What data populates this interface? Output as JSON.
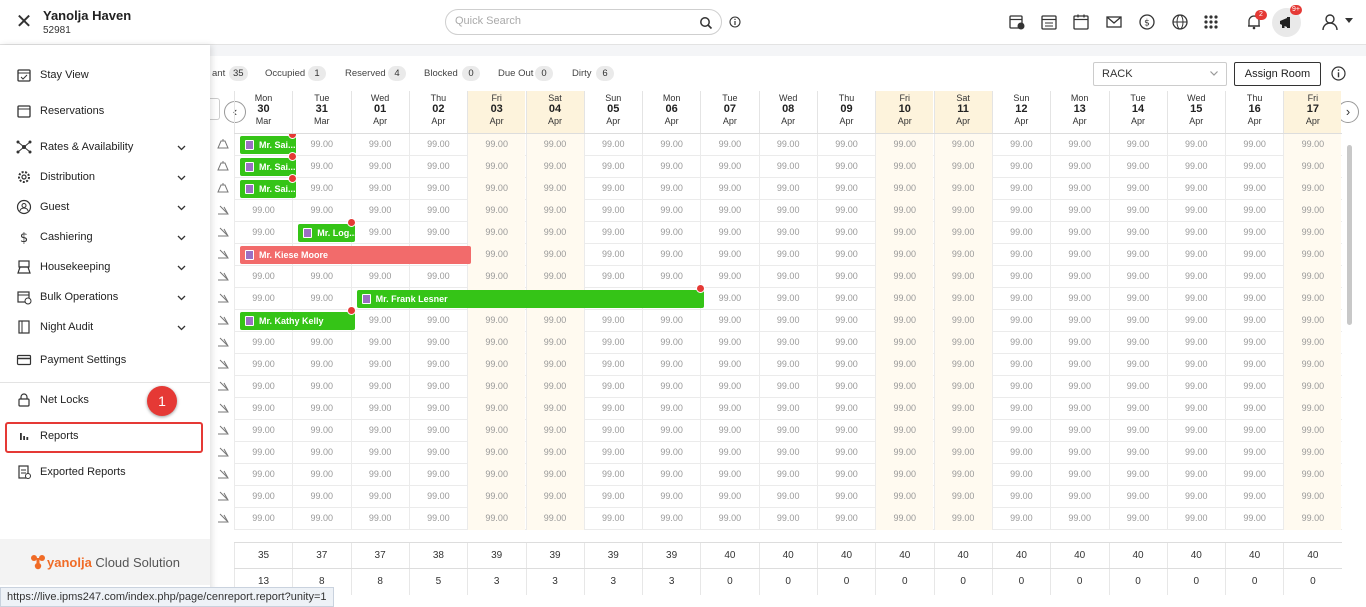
{
  "header": {
    "hotel_name": "Yanolja Haven",
    "hotel_id": "52981",
    "search_placeholder": "Quick Search",
    "notification_count": "2",
    "announcement_count": "9+"
  },
  "stats": [
    {
      "label": "ant",
      "value": "35"
    },
    {
      "label": "Occupied",
      "value": "1"
    },
    {
      "label": "Reserved",
      "value": "4"
    },
    {
      "label": "Blocked",
      "value": "0"
    },
    {
      "label": "Due Out",
      "value": "0"
    },
    {
      "label": "Dirty",
      "value": "6"
    }
  ],
  "toolbar": {
    "rate_select": "RACK",
    "assign_room": "Assign Room"
  },
  "dates": [
    {
      "dow": "Mon",
      "day": "30",
      "mon": "Mar",
      "weekend": false
    },
    {
      "dow": "Tue",
      "day": "31",
      "mon": "Mar",
      "weekend": false
    },
    {
      "dow": "Wed",
      "day": "01",
      "mon": "Apr",
      "weekend": false
    },
    {
      "dow": "Thu",
      "day": "02",
      "mon": "Apr",
      "weekend": false
    },
    {
      "dow": "Fri",
      "day": "03",
      "mon": "Apr",
      "weekend": true
    },
    {
      "dow": "Sat",
      "day": "04",
      "mon": "Apr",
      "weekend": true
    },
    {
      "dow": "Sun",
      "day": "05",
      "mon": "Apr",
      "weekend": false
    },
    {
      "dow": "Mon",
      "day": "06",
      "mon": "Apr",
      "weekend": false
    },
    {
      "dow": "Tue",
      "day": "07",
      "mon": "Apr",
      "weekend": false
    },
    {
      "dow": "Wed",
      "day": "08",
      "mon": "Apr",
      "weekend": false
    },
    {
      "dow": "Thu",
      "day": "09",
      "mon": "Apr",
      "weekend": false
    },
    {
      "dow": "Fri",
      "day": "10",
      "mon": "Apr",
      "weekend": true
    },
    {
      "dow": "Sat",
      "day": "11",
      "mon": "Apr",
      "weekend": true
    },
    {
      "dow": "Sun",
      "day": "12",
      "mon": "Apr",
      "weekend": false
    },
    {
      "dow": "Mon",
      "day": "13",
      "mon": "Apr",
      "weekend": false
    },
    {
      "dow": "Tue",
      "day": "14",
      "mon": "Apr",
      "weekend": false
    },
    {
      "dow": "Wed",
      "day": "15",
      "mon": "Apr",
      "weekend": false
    },
    {
      "dow": "Thu",
      "day": "16",
      "mon": "Apr",
      "weekend": false
    },
    {
      "dow": "Fri",
      "day": "17",
      "mon": "Apr",
      "weekend": true
    }
  ],
  "rate_value": "99.00",
  "room_rows": 18,
  "bookings": [
    {
      "name": "Mr. Sai...",
      "row": 0,
      "start": 0,
      "span": 1,
      "color": "green"
    },
    {
      "name": "Mr. Sai...",
      "row": 1,
      "start": 0,
      "span": 1,
      "color": "green"
    },
    {
      "name": "Mr. Sai...",
      "row": 2,
      "start": 0,
      "span": 1,
      "color": "green"
    },
    {
      "name": "Mr. Log...",
      "row": 4,
      "start": 1,
      "span": 1,
      "color": "green"
    },
    {
      "name": "Mr. Kiese Moore",
      "row": 5,
      "start": 0,
      "span": 4,
      "color": "red"
    },
    {
      "name": "Mr. Frank Lesner",
      "row": 7,
      "start": 2,
      "span": 6,
      "color": "green"
    },
    {
      "name": "Mr. Kathy Kelly",
      "row": 8,
      "start": 0,
      "span": 2,
      "color": "green"
    }
  ],
  "footer": {
    "available": [
      "35",
      "37",
      "37",
      "38",
      "39",
      "39",
      "39",
      "39",
      "40",
      "40",
      "40",
      "40",
      "40",
      "40",
      "40",
      "40",
      "40",
      "40",
      "40"
    ],
    "second": [
      "13",
      "8",
      "8",
      "5",
      "3",
      "3",
      "3",
      "3",
      "0",
      "0",
      "0",
      "0",
      "0",
      "0",
      "0",
      "0",
      "0",
      "0",
      "0"
    ]
  },
  "sidebar": {
    "items": [
      {
        "label": "Stay View",
        "icon": "calendar-check-icon",
        "chevron": false
      },
      {
        "label": "Reservations",
        "icon": "calendar-icon",
        "chevron": false
      },
      {
        "label": "Rates & Availability",
        "icon": "network-icon",
        "chevron": true
      },
      {
        "label": "Distribution",
        "icon": "gear-icon",
        "chevron": true
      },
      {
        "label": "Guest",
        "icon": "guest-icon",
        "chevron": true
      },
      {
        "label": "Cashiering",
        "icon": "dollar-icon",
        "chevron": true
      },
      {
        "label": "Housekeeping",
        "icon": "broom-icon",
        "chevron": true
      },
      {
        "label": "Bulk Operations",
        "icon": "bulk-icon",
        "chevron": true
      },
      {
        "label": "Night Audit",
        "icon": "document-icon",
        "chevron": true
      },
      {
        "label": "Payment Settings",
        "icon": "card-icon",
        "chevron": false
      },
      {
        "label": "Net Locks",
        "icon": "lock-icon",
        "chevron": false
      },
      {
        "label": "Reports",
        "icon": "bar-chart-icon",
        "chevron": false
      },
      {
        "label": "Exported Reports",
        "icon": "export-icon",
        "chevron": false
      }
    ],
    "step_number": "1",
    "brand_name": "yanolja",
    "brand_suffix": "Cloud Solution"
  },
  "status_url": "https://live.ipms247.com/index.php/page/cenreport.report?unity=1",
  "colors": {
    "booking_green": "#35c417",
    "booking_red": "#f26b6b",
    "highlight_red": "#e53935",
    "weekend": "#fdf3dc"
  }
}
